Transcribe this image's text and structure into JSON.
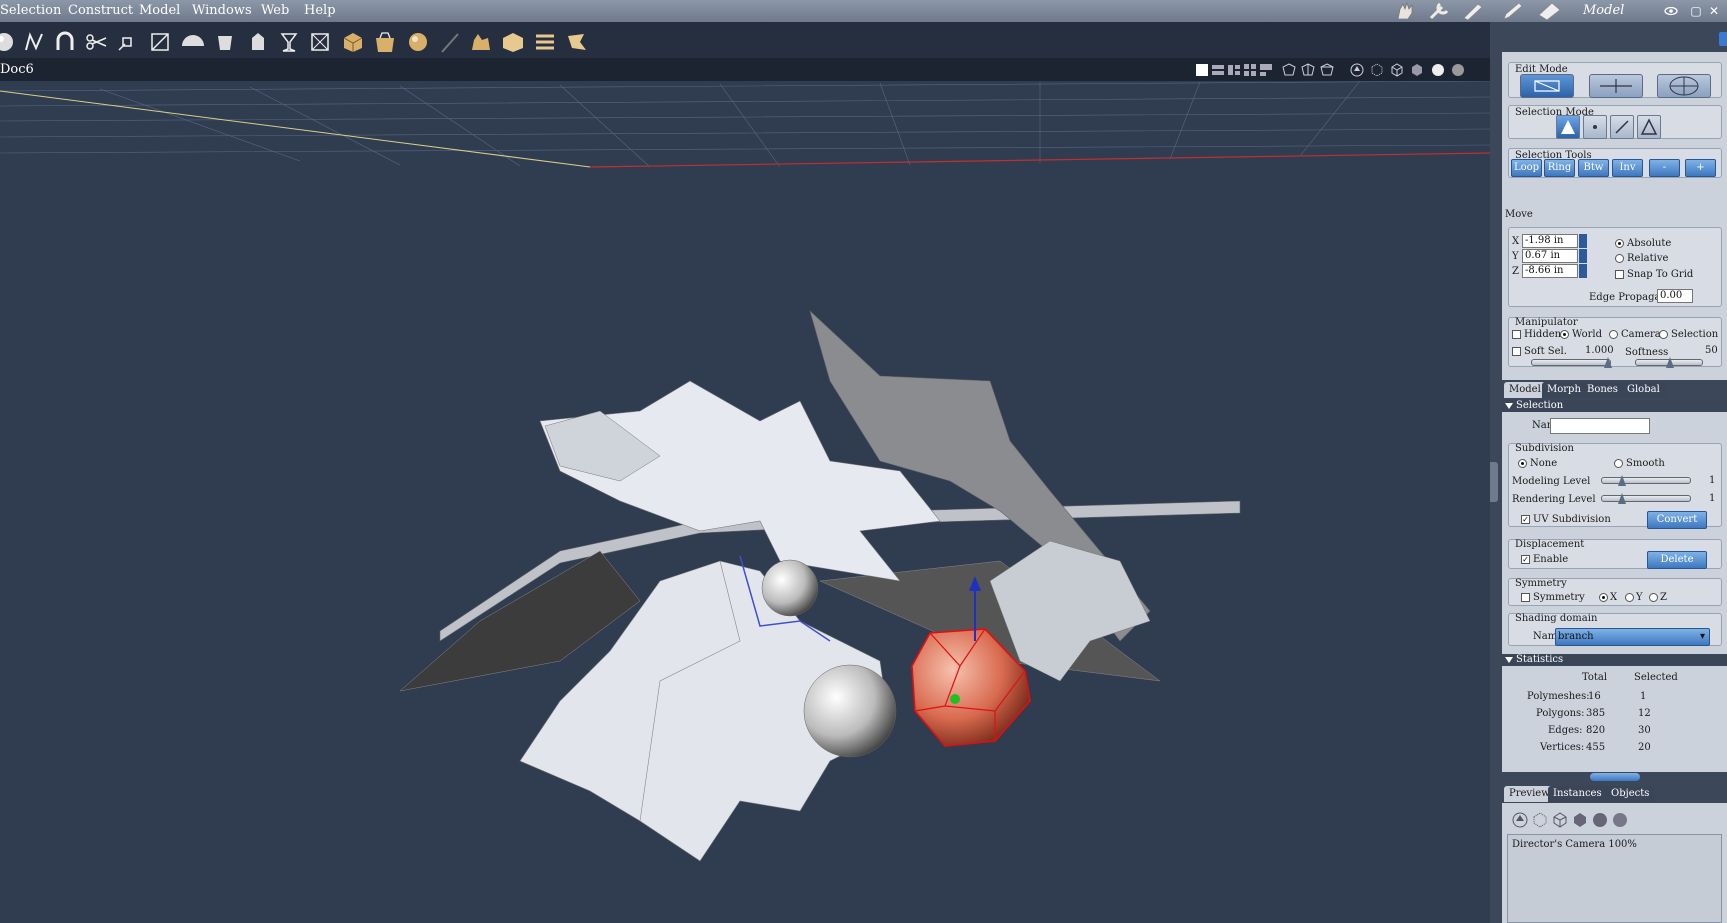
{
  "menu": [
    "Selection",
    "Construct",
    "Model",
    "Windows",
    "Web",
    "Help"
  ],
  "room": {
    "label": "Model"
  },
  "document": {
    "title": "Doc6"
  },
  "toolbar_icons": [
    "sphere-icon",
    "spline-icon",
    "magnet-icon",
    "scissors-icon",
    "scale-icon",
    "crop-icon",
    "half-sphere-icon",
    "lathe-icon",
    "extrude-icon",
    "goblet-icon",
    "box-outline-icon",
    "cube-icon",
    "bag-icon",
    "ball-icon",
    "pen-icon",
    "hand-icon",
    "pillow-icon",
    "align-icon",
    "fold-icon"
  ],
  "panel": {
    "edit_mode": {
      "label": "Edit Mode"
    },
    "selection_mode": {
      "label": "Selection Mode"
    },
    "selection_tools": {
      "label": "Selection Tools",
      "buttons": [
        "Loop",
        "Ring",
        "Btw",
        "Inv",
        "-",
        "+"
      ]
    },
    "move": {
      "label": "Move",
      "x_label": "X",
      "x_value": "-1.98 in",
      "y_label": "Y",
      "y_value": "0.67 in",
      "z_label": "Z",
      "z_value": "-8.66 in",
      "absolute": "Absolute",
      "relative": "Relative",
      "snap": "Snap To Grid",
      "edge_prop_label": "Edge Propagation",
      "edge_prop_value": "0.00"
    },
    "manipulator": {
      "label": "Manipulator",
      "hidden": "Hidden",
      "world": "World",
      "camera": "Camera",
      "selection": "Selection",
      "soft_sel": "Soft Sel.",
      "soft_sel_value": "1.000",
      "softness": "Softness",
      "softness_value": "50"
    },
    "tabs": [
      "Model",
      "Morph",
      "Bones",
      "Global"
    ],
    "selection_section": {
      "label": "Selection",
      "name_label": "Name",
      "name_value": ""
    },
    "subdivision": {
      "label": "Subdivision",
      "none": "None",
      "smooth": "Smooth",
      "modeling": "Modeling Level",
      "modeling_value": "1",
      "rendering": "Rendering Level",
      "rendering_value": "1",
      "uv": "UV Subdivision",
      "convert": "Convert"
    },
    "displacement": {
      "label": "Displacement",
      "enable": "Enable",
      "delete": "Delete"
    },
    "symmetry": {
      "label": "Symmetry",
      "check": "Symmetry",
      "x": "X",
      "y": "Y",
      "z": "Z"
    },
    "shading": {
      "label": "Shading domain",
      "name_label": "Name",
      "value": "branch"
    },
    "statistics": {
      "label": "Statistics",
      "total_header": "Total",
      "selected_header": "Selected",
      "rows": [
        {
          "label": "Polymeshes:",
          "total": "16",
          "selected": "1"
        },
        {
          "label": "Polygons:",
          "total": "385",
          "selected": "12"
        },
        {
          "label": "Edges:",
          "total": "820",
          "selected": "30"
        },
        {
          "label": "Vertices:",
          "total": "455",
          "selected": "20"
        }
      ]
    },
    "bottom_tabs": [
      "Preview",
      "Instances",
      "Objects"
    ],
    "preview_caption": "Director's Camera 100%"
  }
}
